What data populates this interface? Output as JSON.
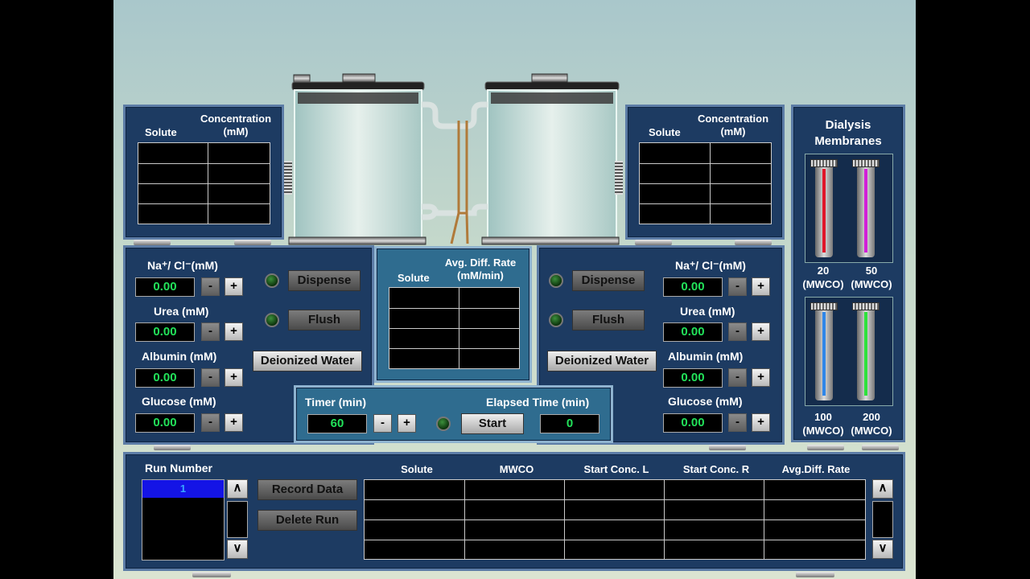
{
  "left_conc": {
    "col_solute": "Solute",
    "col_conc": "Concentration\n(mM)"
  },
  "right_conc": {
    "col_solute": "Solute",
    "col_conc": "Concentration\n(mM)"
  },
  "membranes": {
    "title": "Dialysis\nMembranes",
    "items": [
      {
        "label": "20\n(MWCO)",
        "color": "#e0162a"
      },
      {
        "label": "50\n(MWCO)",
        "color": "#d21ed8"
      },
      {
        "label": "100\n(MWCO)",
        "color": "#2f86e8"
      },
      {
        "label": "200\n(MWCO)",
        "color": "#2ee23c"
      }
    ]
  },
  "left_controls": {
    "na": {
      "label": "Na⁺/ Cl⁻(mM)",
      "value": "0.00"
    },
    "urea": {
      "label": "Urea (mM)",
      "value": "0.00"
    },
    "albumin": {
      "label": "Albumin (mM)",
      "value": "0.00"
    },
    "glucose": {
      "label": "Glucose (mM)",
      "value": "0.00"
    },
    "dispense": "Dispense",
    "flush": "Flush",
    "deionized": "Deionized Water"
  },
  "right_controls": {
    "na": {
      "label": "Na⁺/ Cl⁻(mM)",
      "value": "0.00"
    },
    "urea": {
      "label": "Urea (mM)",
      "value": "0.00"
    },
    "albumin": {
      "label": "Albumin (mM)",
      "value": "0.00"
    },
    "glucose": {
      "label": "Glucose (mM)",
      "value": "0.00"
    },
    "dispense": "Dispense",
    "flush": "Flush",
    "deionized": "Deionized Water"
  },
  "rate_panel": {
    "col_solute": "Solute",
    "col_rate": "Avg. Diff. Rate\n(mM/min)"
  },
  "timer": {
    "label": "Timer (min)",
    "value": "60",
    "elapsed_label": "Elapsed Time (min)",
    "elapsed_value": "0",
    "start": "Start"
  },
  "runs": {
    "title": "Run Number",
    "selected": "1",
    "record": "Record Data",
    "delete": "Delete Run",
    "columns": [
      "Solute",
      "MWCO",
      "Start Conc. L",
      "Start Conc. R",
      "Avg.Diff. Rate"
    ],
    "scroll_up": "∧",
    "scroll_down": "∨"
  },
  "stepper": {
    "minus": "-",
    "plus": "+"
  }
}
